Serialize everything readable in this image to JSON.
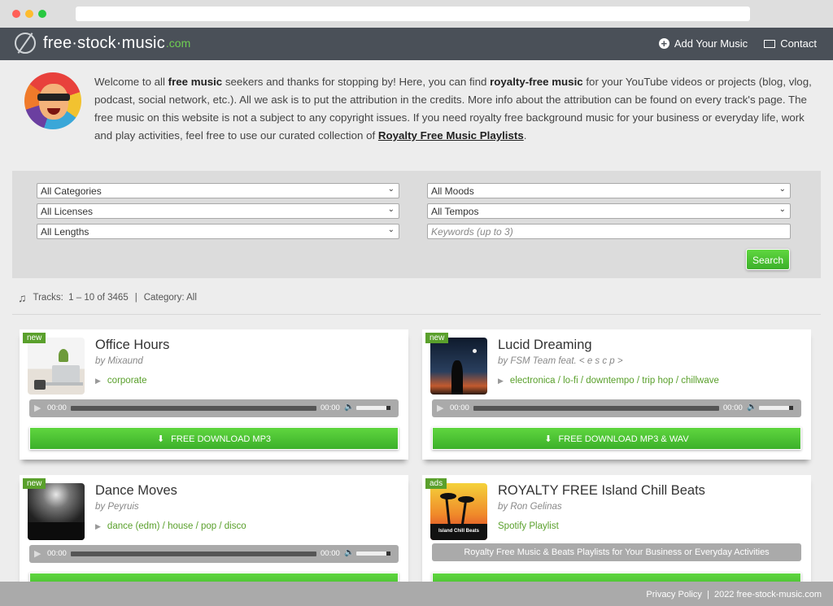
{
  "header": {
    "logo_text": "free·stock·music",
    "logo_tld": ".com",
    "nav": [
      {
        "label": "Add Your Music",
        "icon": "plus-circle-icon"
      },
      {
        "label": "Contact",
        "icon": "envelope-icon"
      }
    ]
  },
  "intro": {
    "p1": "Welcome to all ",
    "b1": "free music",
    "p2": " seekers and thanks for stopping by! Here, you can find ",
    "b2": "royalty-free music",
    "p3": " for your YouTube videos or projects (blog, vlog, podcast, social network, etc.). All we ask is to put the attribution in the credits. More info about the attribution can be found on every track's page. The free music on this website is not a subject to any copyright issues. If you need royalty free background music for your business or everyday life, work and play activities, feel free to use our curated collection of ",
    "link": "Royalty Free Music Playlists",
    "p4": "."
  },
  "filters": {
    "categories": "All Categories",
    "moods": "All Moods",
    "licenses": "All Licenses",
    "tempos": "All Tempos",
    "lengths": "All Lengths",
    "keywords_placeholder": "Keywords (up to 3)",
    "search_label": "Search"
  },
  "tracks_info": {
    "label": "Tracks:",
    "range": "1 – 10 of 3465",
    "category": "Category: All"
  },
  "cards": [
    {
      "badge": "new",
      "title": "Office Hours",
      "artist": "by Mixaund",
      "tags": "corporate",
      "time_start": "00:00",
      "time_end": "00:00",
      "button": "FREE DOWNLOAD  MP3"
    },
    {
      "badge": "new",
      "title": "Lucid Dreaming",
      "artist": "by FSM Team feat. < e s c p >",
      "tags": "electronica / lo-fi / downtempo / trip hop / chillwave",
      "time_start": "00:00",
      "time_end": "00:00",
      "button": "FREE DOWNLOAD  MP3 & WAV"
    },
    {
      "badge": "new",
      "title": "Dance Moves",
      "artist": "by Peyruis",
      "tags": "dance (edm) / house / pop / disco",
      "time_start": "00:00",
      "time_end": "00:00",
      "button": ""
    },
    {
      "badge": "ads",
      "title": "ROYALTY FREE Island Chill Beats",
      "artist": "by Ron Gelinas",
      "tags": "Spotify Playlist",
      "thumb_caption": "Island Chill Beats",
      "grey_button": "Royalty Free Music & Beats Playlists for Your Business or Everyday Activities"
    }
  ],
  "footer": {
    "privacy": "Privacy Policy",
    "separator": "|",
    "copyright": "2022  free-stock-music.com"
  }
}
